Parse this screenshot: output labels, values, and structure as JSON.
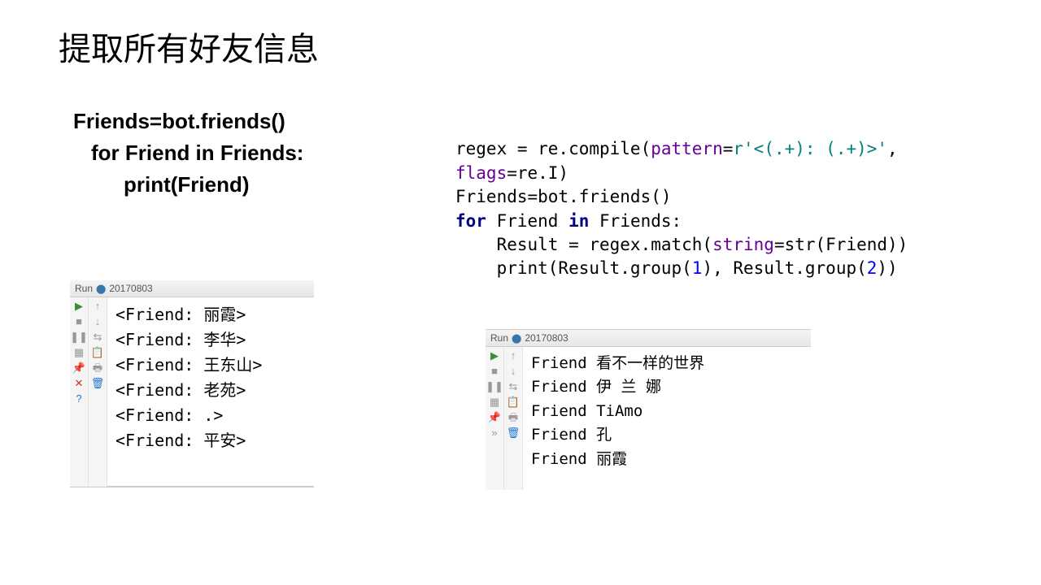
{
  "title": "提取所有好友信息",
  "left_code": {
    "l1": "Friends=bot.friends()",
    "l2": "for Friend in Friends:",
    "l3": "print(Friend)"
  },
  "right_code": {
    "t1a": "regex = re.compile(",
    "t1b": "pattern",
    "t1c": "=",
    "t1d": "r'<(.+): (.+)>'",
    "t1e": ",",
    "t2a": "flags",
    "t2b": "=re.I)",
    "t3": "Friends=bot.friends()",
    "t4a": "for",
    "t4b": " Friend ",
    "t4c": "in",
    "t4d": " Friends:",
    "t5a": "    Result = regex.match(",
    "t5b": "string",
    "t5c": "=str(Friend))",
    "t6a": "    print(Result.group(",
    "t6b": "1",
    "t6c": "), Result.group(",
    "t6d": "2",
    "t6e": "))"
  },
  "run_label": "Run",
  "run_tab": "20170803",
  "panel1_output": [
    "<Friend: 丽霞>",
    "<Friend: 李华>",
    "<Friend: 王东山>",
    "<Friend: 老苑>",
    "<Friend: .>",
    "<Friend: 平安>"
  ],
  "panel2_output": [
    "Friend 看不一样的世界",
    "Friend 伊 兰 娜",
    "Friend TiAmo",
    "Friend 孔",
    "Friend 丽霞"
  ],
  "icons": {
    "run": "▶",
    "stop": "■",
    "pause": "❚❚",
    "layout": "▦",
    "pin": "📌",
    "close": "✕",
    "help": "?",
    "up": "↑",
    "down": "↓",
    "wrap": "⇆",
    "print": "🖶",
    "export": "📋",
    "trash": "🗑",
    "more": "»"
  }
}
